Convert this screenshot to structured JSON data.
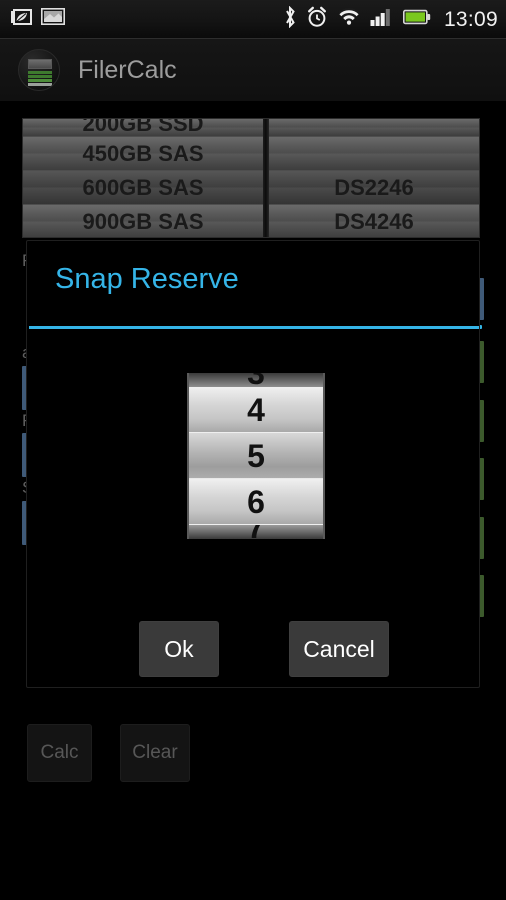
{
  "status_bar": {
    "icons_left": [
      "eco-leaf-icon",
      "screenshot-icon"
    ],
    "icons_right": [
      "bluetooth-icon",
      "alarm-clock-icon",
      "wifi-icon",
      "signal-bars-icon",
      "battery-icon"
    ],
    "clock": "13:09"
  },
  "action_bar": {
    "app_icon": "filer-rack-icon",
    "title": "FilerCalc"
  },
  "background": {
    "disk_table": {
      "left_column": [
        "200GB SSD",
        "450GB SAS",
        "600GB SAS",
        "900GB SAS"
      ],
      "right_column": [
        "",
        "",
        "DS2246",
        "DS4246"
      ]
    },
    "field_labels": [
      "F",
      "a",
      "R",
      "S"
    ],
    "buttons": {
      "calc": "Calc",
      "clear": "Clear"
    }
  },
  "dialog": {
    "title": "Snap Reserve",
    "accent_color": "#35b5e8",
    "number_picker": {
      "partial_top": "3",
      "above": "4",
      "selected": "5",
      "below": "6",
      "partial_bottom": "7"
    },
    "ok_label": "Ok",
    "cancel_label": "Cancel"
  }
}
